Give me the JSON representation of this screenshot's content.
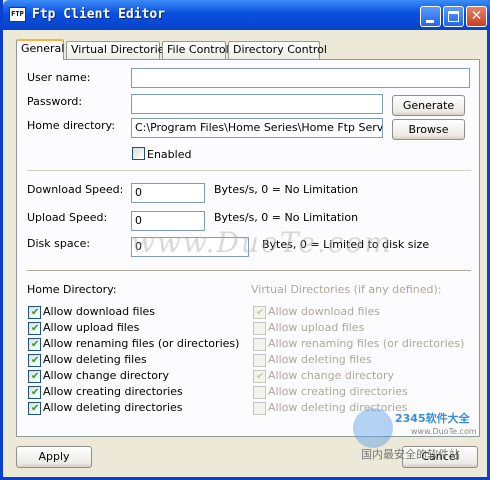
{
  "window": {
    "title": "Ftp Client Editor",
    "icon_text": "FTP",
    "controls": [
      "minimize-icon",
      "maximize-icon",
      "close-icon"
    ]
  },
  "tabs": [
    {
      "label": "General",
      "active": true
    },
    {
      "label": "Virtual Directories",
      "active": false
    },
    {
      "label": "File Control",
      "active": false
    },
    {
      "label": "Directory Control",
      "active": false
    }
  ],
  "general": {
    "user_name_label": "User name:",
    "user_name_value": "",
    "password_label": "Password:",
    "password_value": "",
    "generate_button": "Generate",
    "home_directory_label": "Home directory:",
    "home_directory_value": "C:\\Program Files\\Home Series\\Home Ftp Server",
    "browse_button": "Browse",
    "enabled_label": "Enabled",
    "enabled_checked": false,
    "download_speed_label": "Download Speed:",
    "download_speed_value": "0",
    "download_speed_hint": "Bytes/s, 0 = No Limitation",
    "upload_speed_label": "Upload Speed:",
    "upload_speed_value": "0",
    "upload_speed_hint": "Bytes/s, 0 = No Limitation",
    "disk_space_label": "Disk space:",
    "disk_space_value": "0",
    "disk_space_hint": "Bytes, 0 = Limited to disk size"
  },
  "home_permissions": {
    "title": "Home Directory:",
    "items": [
      {
        "label": "Allow download files",
        "checked": true
      },
      {
        "label": "Allow upload files",
        "checked": true
      },
      {
        "label": "Allow renaming files (or directories)",
        "checked": true
      },
      {
        "label": "Allow deleting files",
        "checked": true
      },
      {
        "label": "Allow change directory",
        "checked": true
      },
      {
        "label": "Allow creating directories",
        "checked": true
      },
      {
        "label": "Allow deleting directories",
        "checked": true
      }
    ]
  },
  "virtual_permissions": {
    "title": "Virtual Directories (if any defined):",
    "items": [
      {
        "label": "Allow download files",
        "checked": true
      },
      {
        "label": "Allow upload files",
        "checked": false
      },
      {
        "label": "Allow renaming files (or directories)",
        "checked": false
      },
      {
        "label": "Allow deleting files",
        "checked": false
      },
      {
        "label": "Allow change directory",
        "checked": true
      },
      {
        "label": "Allow creating directories",
        "checked": false
      },
      {
        "label": "Allow deleting directories",
        "checked": false
      }
    ]
  },
  "footer": {
    "apply_button": "Apply",
    "cancel_button": "Cancel"
  },
  "watermark": {
    "text": "www.DuoTe.com",
    "logo_text": "2345软件大全",
    "logo_url": "www.DuoTe.com",
    "bottom_text": "国内最安全的软件站"
  },
  "colors": {
    "titlebar": "#0a4fe0",
    "tab_highlight": "#f9b33b",
    "check": "#21a121"
  }
}
